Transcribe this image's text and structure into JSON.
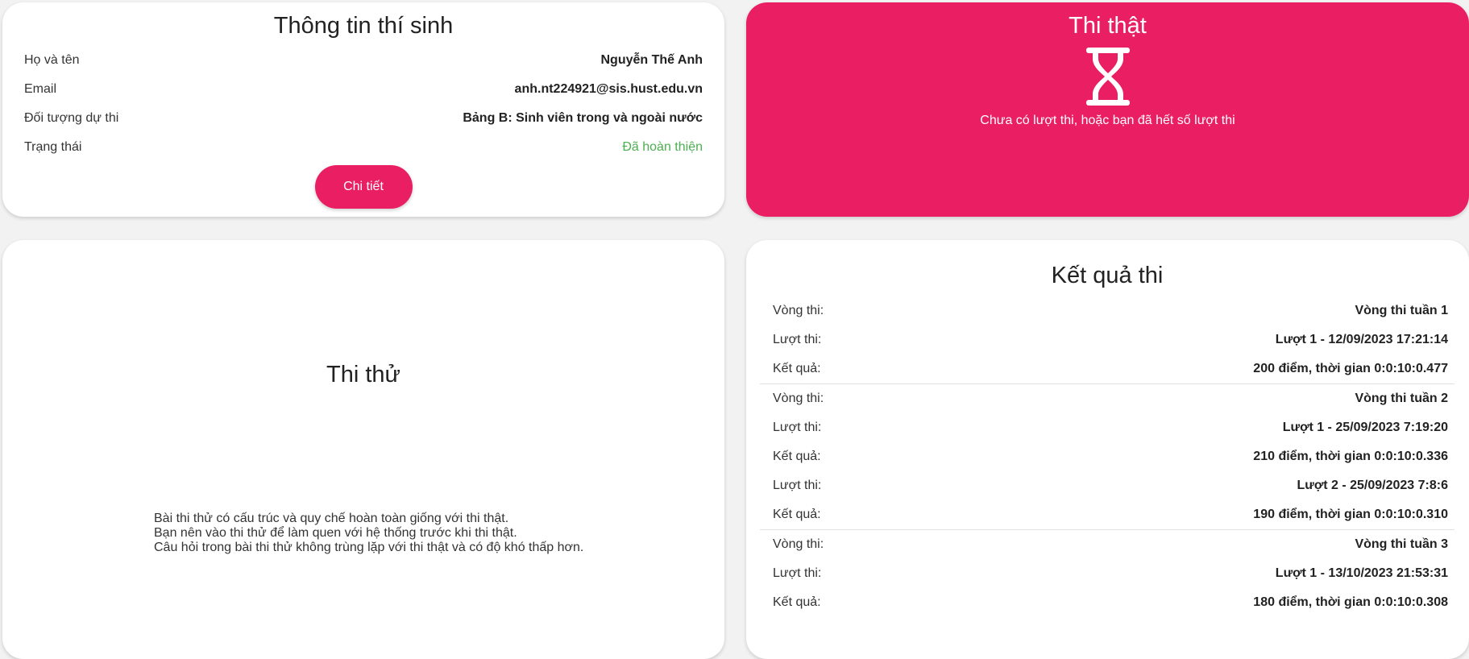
{
  "info": {
    "title": "Thông tin thí sinh",
    "rows": [
      {
        "label": "Họ và tên",
        "value": "Nguyễn Thế Anh"
      },
      {
        "label": "Email",
        "value": "anh.nt224921@sis.hust.edu.vn"
      },
      {
        "label": "Đối tượng dự thi",
        "value": "Bảng B: Sinh viên trong và ngoài nước"
      },
      {
        "label": "Trạng thái",
        "value": "Đã hoàn thiện"
      }
    ],
    "detail_button": "Chi tiết"
  },
  "real_exam": {
    "title": "Thi thật",
    "message": "Chưa có lượt thi, hoặc bạn đã hết số lượt thi",
    "icon": "hourglass-icon"
  },
  "trial_exam": {
    "title": "Thi thử",
    "lines": [
      "Bài thi thử có cấu trúc và quy chế hoàn toàn giống với thi thật.",
      "Bạn nên vào thi thử để làm quen với hệ thống trước khi thi thật.",
      "Câu hỏi trong bài thi thử không trùng lặp với thi thật và có độ khó thấp hơn."
    ]
  },
  "results": {
    "title": "Kết quả thi",
    "labels": {
      "round": "Vòng thi:",
      "attempt": "Lượt thi:",
      "result": "Kết quả:"
    },
    "groups": [
      {
        "round": "Vòng thi tuần 1",
        "attempts": [
          {
            "attempt": "Lượt 1 - 12/09/2023 17:21:14",
            "result": "200 điểm, thời gian 0:0:10:0.477"
          }
        ]
      },
      {
        "round": "Vòng thi tuần 2",
        "attempts": [
          {
            "attempt": "Lượt 1 - 25/09/2023 7:19:20",
            "result": "210 điểm, thời gian 0:0:10:0.336"
          },
          {
            "attempt": "Lượt 2 - 25/09/2023 7:8:6",
            "result": "190 điểm, thời gian 0:0:10:0.310"
          }
        ]
      },
      {
        "round": "Vòng thi tuần 3",
        "attempts": [
          {
            "attempt": "Lượt 1 - 13/10/2023 21:53:31",
            "result": "180 điểm, thời gian 0:0:10:0.308"
          }
        ]
      }
    ]
  },
  "colors": {
    "accent": "#e91e63",
    "success": "#4caf50",
    "background": "#f2f2f2"
  }
}
